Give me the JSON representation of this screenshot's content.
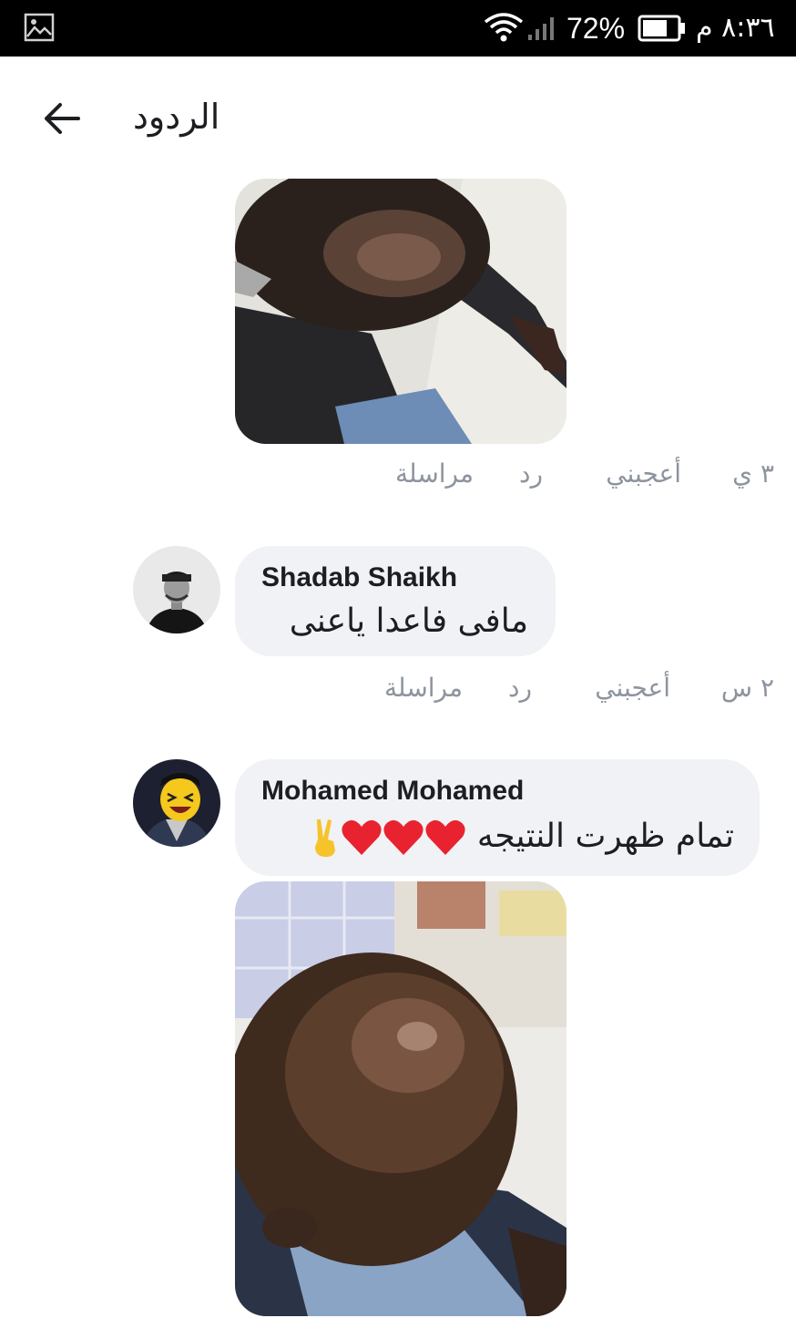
{
  "status_bar": {
    "gallery_icon": "image-icon",
    "wifi_icon": "wifi-icon",
    "signal_icon": "signal-icon",
    "battery_percent": "72%",
    "battery_icon": "battery-icon",
    "time": "٨:٣٦ م"
  },
  "header": {
    "back_icon": "arrow-left-icon",
    "title": "الردود"
  },
  "replies": [
    {
      "type": "photo",
      "photo_desc": "photo",
      "actions": {
        "time": "٣ ي",
        "like": "أعجبني",
        "reply": "رد",
        "message": "مراسلة"
      }
    },
    {
      "type": "comment",
      "author": "Shadab Shaikh",
      "text": "مافى فاعدا ياعنى",
      "actions": {
        "time": "٢ س",
        "like": "أعجبني",
        "reply": "رد",
        "message": "مراسلة"
      }
    },
    {
      "type": "comment",
      "author": "Mohamed Mohamed",
      "text": "تمام ظهرت النتيجه",
      "emojis": [
        "heart-emoji",
        "heart-emoji",
        "heart-emoji",
        "victory-hand-emoji"
      ]
    }
  ],
  "colors": {
    "status_bar_bg": "#000000",
    "bubble_bg": "#f0f2f5",
    "meta_text": "#8d949e",
    "heart": "#e8232f"
  }
}
